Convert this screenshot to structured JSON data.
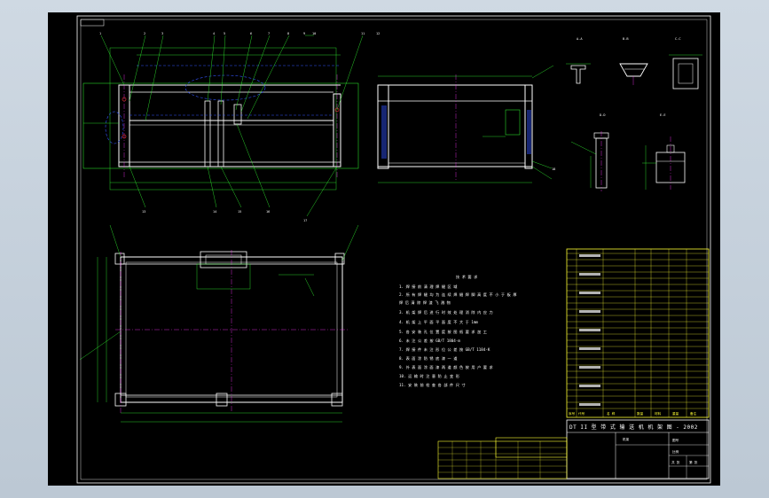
{
  "drawing": {
    "title_tab": "",
    "bubbles_top": [
      "1",
      "2",
      "3",
      "4",
      "5",
      "6",
      "7",
      "8",
      "9",
      "10",
      "11",
      "12"
    ],
    "bubbles_bottom": [
      "13",
      "14",
      "15",
      "16",
      "17",
      "18"
    ],
    "section_labels": [
      "A-A",
      "B-B",
      "C-C",
      "D-D",
      "E-E"
    ],
    "tech_req_title": "技 术 要 求",
    "tech_req_lines": [
      "1. 焊 接 前 清 理 焊 缝 区 域",
      "2. 所 有 焊 缝 均 为 连 续 焊 缝 焊 脚 高 度 不 小 于 板 厚",
      "   焊 后 清 除 焊 渣 飞 溅 物",
      "3. 机 架 焊 后 进 行 时 效 处 理 消 除 内 应 力",
      "4. 机 架 上 平 面 平 面 度 不 大 于 1mm",
      "5. 各 安 装 孔 位 置 度 按 图 纸 要 求 加 工",
      "6. 未 注 公 差 按 GB/T 1804-m",
      "7. 焊 接 件 未 注 形 位 公 差 按 GB/T 1184-K",
      "8. 表 面 涂 防 锈 底 漆 一 道",
      "9. 外 表 面 涂 面 漆 两 道 颜 色 按 用 户 要 求",
      "10. 运 输 时 注 意 防 止 变 形",
      "11. 安 装 前 检 查 各 部 件 尺 寸"
    ],
    "bom_header": [
      "序号",
      "代号",
      "名 称",
      "数量",
      "材料",
      "重量",
      "备注"
    ],
    "title_block_main": "DT II 型 带 式 输 送 机 机 架 图 - 2002",
    "title_block_cells": [
      "机架",
      "图号",
      "比例",
      "共 张",
      "第 张"
    ]
  },
  "colors": {
    "background": "#000000",
    "frame": "#ffffff",
    "table": "#ffff33",
    "dimension": "#33ff33",
    "centerline": "#ff33ff",
    "hidden": "#3333ff"
  }
}
